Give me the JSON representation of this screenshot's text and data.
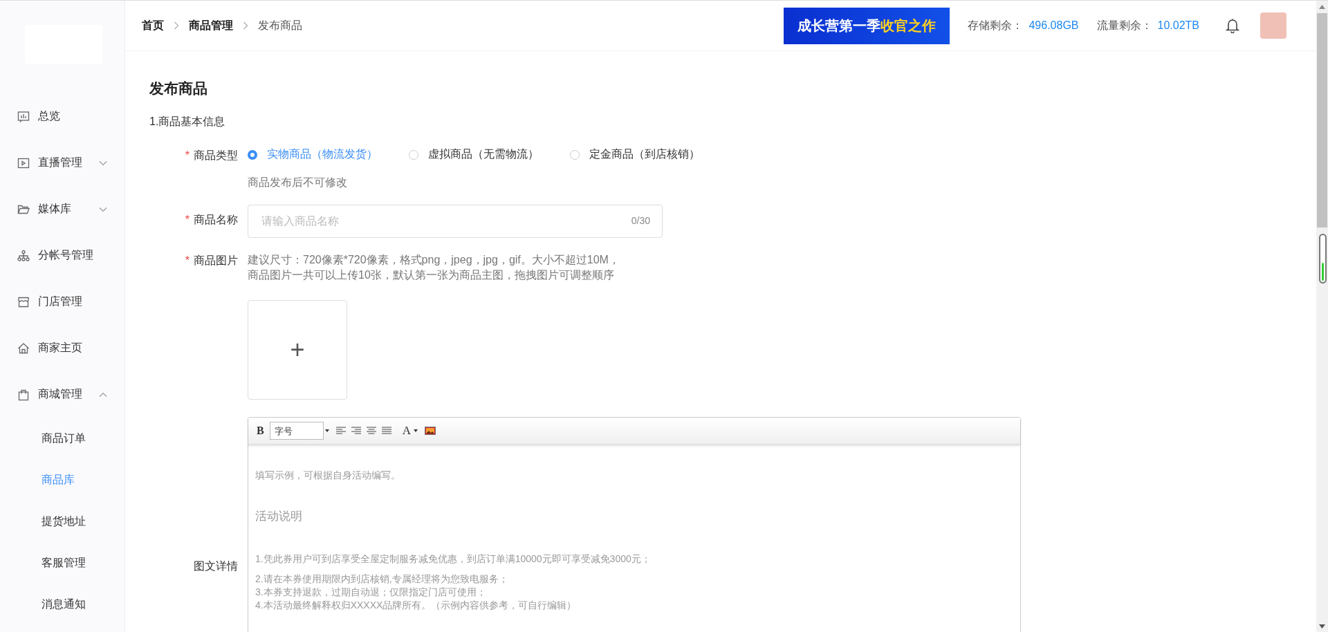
{
  "sidebar": {
    "items": [
      {
        "label": "总览"
      },
      {
        "label": "直播管理",
        "expanded": false
      },
      {
        "label": "媒体库",
        "expanded": false
      },
      {
        "label": "分帐号管理"
      },
      {
        "label": "门店管理"
      },
      {
        "label": "商家主页"
      },
      {
        "label": "商城管理",
        "expanded": true,
        "children": [
          {
            "label": "商品订单",
            "selected": false
          },
          {
            "label": "商品库",
            "selected": true
          },
          {
            "label": "提货地址",
            "selected": false
          },
          {
            "label": "客服管理",
            "selected": false
          },
          {
            "label": "消息通知",
            "selected": false
          }
        ]
      }
    ]
  },
  "header": {
    "breadcrumb": [
      "首页",
      "商品管理",
      "发布商品"
    ],
    "banner": {
      "text_main": "成长营第一季",
      "text_highlight": "收官之作"
    },
    "stats": [
      {
        "label": "存储剩余：",
        "value": "496.08GB"
      },
      {
        "label": "流量剩余：",
        "value": "10.02TB"
      }
    ]
  },
  "page": {
    "title": "发布商品",
    "section": "1.商品基本信息",
    "product_type": {
      "required_mark": "*",
      "label": "商品类型",
      "options": [
        {
          "label": "实物商品（物流发货）",
          "selected": true
        },
        {
          "label": "虚拟商品（无需物流）",
          "selected": false
        },
        {
          "label": "定金商品（到店核销）",
          "selected": false
        }
      ],
      "hint": "商品发布后不可修改"
    },
    "product_name": {
      "required_mark": "*",
      "label": "商品名称",
      "placeholder": "请输入商品名称",
      "counter": "0/30"
    },
    "product_images": {
      "required_mark": "*",
      "label": "商品图片",
      "hint_lines": [
        "建议尺寸：720像素*720像素，格式png，jpeg，jpg，gif。大小不超过10M，",
        "商品图片一共可以上传10张，默认第一张为商品主图，拖拽图片可调整顺序"
      ],
      "upload_glyph": "+"
    },
    "details": {
      "label": "图文详情",
      "toolbar": {
        "bold": "B",
        "font_size": "字号",
        "font_color": "A"
      },
      "paragraphs": [
        {
          "kind": "note",
          "text": "填写示例，可根据自身活动编写。"
        },
        {
          "kind": "heading",
          "text": "活动说明"
        },
        {
          "kind": "line",
          "text": "1.凭此券用户可到店享受全屋定制服务减免优惠，到店订单满10000元即可享受减免3000元；"
        },
        {
          "kind": "block",
          "text": "2.请在本券使用期限内到店核销,专属经理将为您致电服务；"
        },
        {
          "kind": "block",
          "text": "3.本券支持退款，过期自动退；仅限指定门店可使用；"
        },
        {
          "kind": "block",
          "text": "4.本活动最终解释权归XXXXX品牌所有。（示例内容供参考，可自行编辑）"
        }
      ]
    }
  }
}
